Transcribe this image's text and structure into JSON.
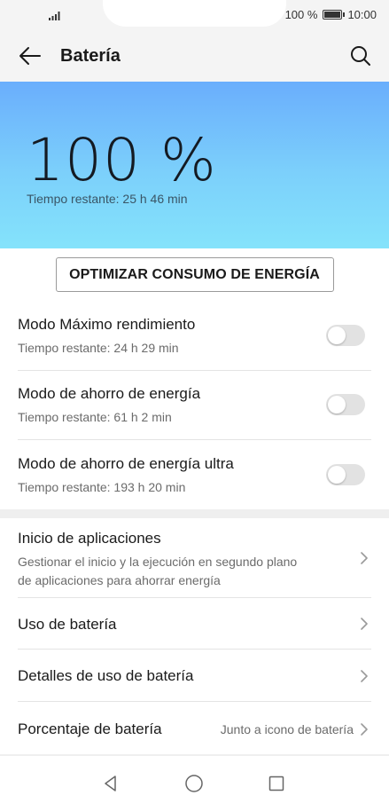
{
  "status_bar": {
    "battery_text": "100 %",
    "time": "10:00",
    "icons": [
      "signal-icon",
      "battery-icon"
    ]
  },
  "app_bar": {
    "title": "Batería",
    "back_icon": "arrow-left-icon",
    "search_icon": "search-icon"
  },
  "hero": {
    "percent": "100 %",
    "remaining": "Tiempo restante: 25 h 46 min",
    "gradient_top": "#6aaefc",
    "gradient_bottom": "#84e3fb"
  },
  "optimize_button": {
    "label": "OPTIMIZAR CONSUMO DE ENERGÍA"
  },
  "modes": [
    {
      "title": "Modo Máximo rendimiento",
      "subtitle": "Tiempo restante: 24 h 29 min",
      "enabled": false
    },
    {
      "title": "Modo de ahorro de energía",
      "subtitle": "Tiempo restante: 61 h 2 min",
      "enabled": false
    },
    {
      "title": "Modo de ahorro de energía ultra",
      "subtitle": "Tiempo restante: 193 h 20 min",
      "enabled": false
    }
  ],
  "settings": [
    {
      "title": "Inicio de aplicaciones",
      "subtitle_line1": "Gestionar el inicio y la ejecución en segundo plano",
      "subtitle_line2": "de aplicaciones para ahorrar energía"
    },
    {
      "title": "Uso de batería"
    },
    {
      "title": "Detalles de uso de batería"
    },
    {
      "title": "Porcentaje de batería",
      "value": "Junto a icono de batería"
    }
  ],
  "nav_bar": {
    "icons": [
      "back-triangle-icon",
      "home-circle-icon",
      "recents-square-icon"
    ]
  }
}
